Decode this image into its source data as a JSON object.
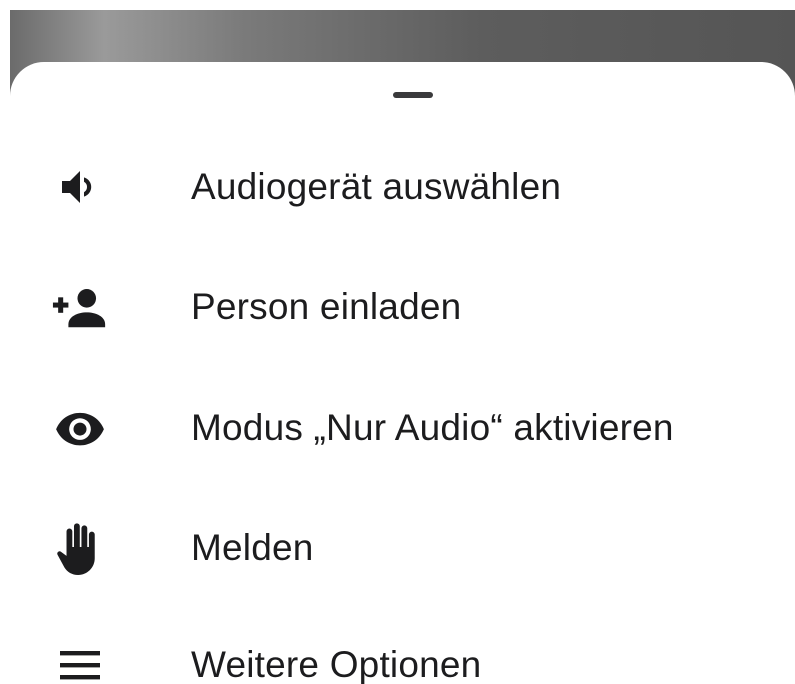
{
  "menu": {
    "items": [
      {
        "id": "audio-device",
        "icon": "speaker-icon",
        "label": "Audiogerät auswählen"
      },
      {
        "id": "invite-person",
        "icon": "add-person-icon",
        "label": "Person einladen"
      },
      {
        "id": "audio-only-mode",
        "icon": "eye-icon",
        "label": "Modus „Nur Audio“ aktivieren"
      },
      {
        "id": "report",
        "icon": "hand-icon",
        "label": "Melden"
      },
      {
        "id": "more-options",
        "icon": "menu-icon",
        "label": "Weitere Optionen"
      }
    ]
  },
  "colors": {
    "icon": "#1c1c1e",
    "text": "#1c1c1e",
    "sheet_background": "#ffffff",
    "backdrop": "#6b6b6b"
  }
}
